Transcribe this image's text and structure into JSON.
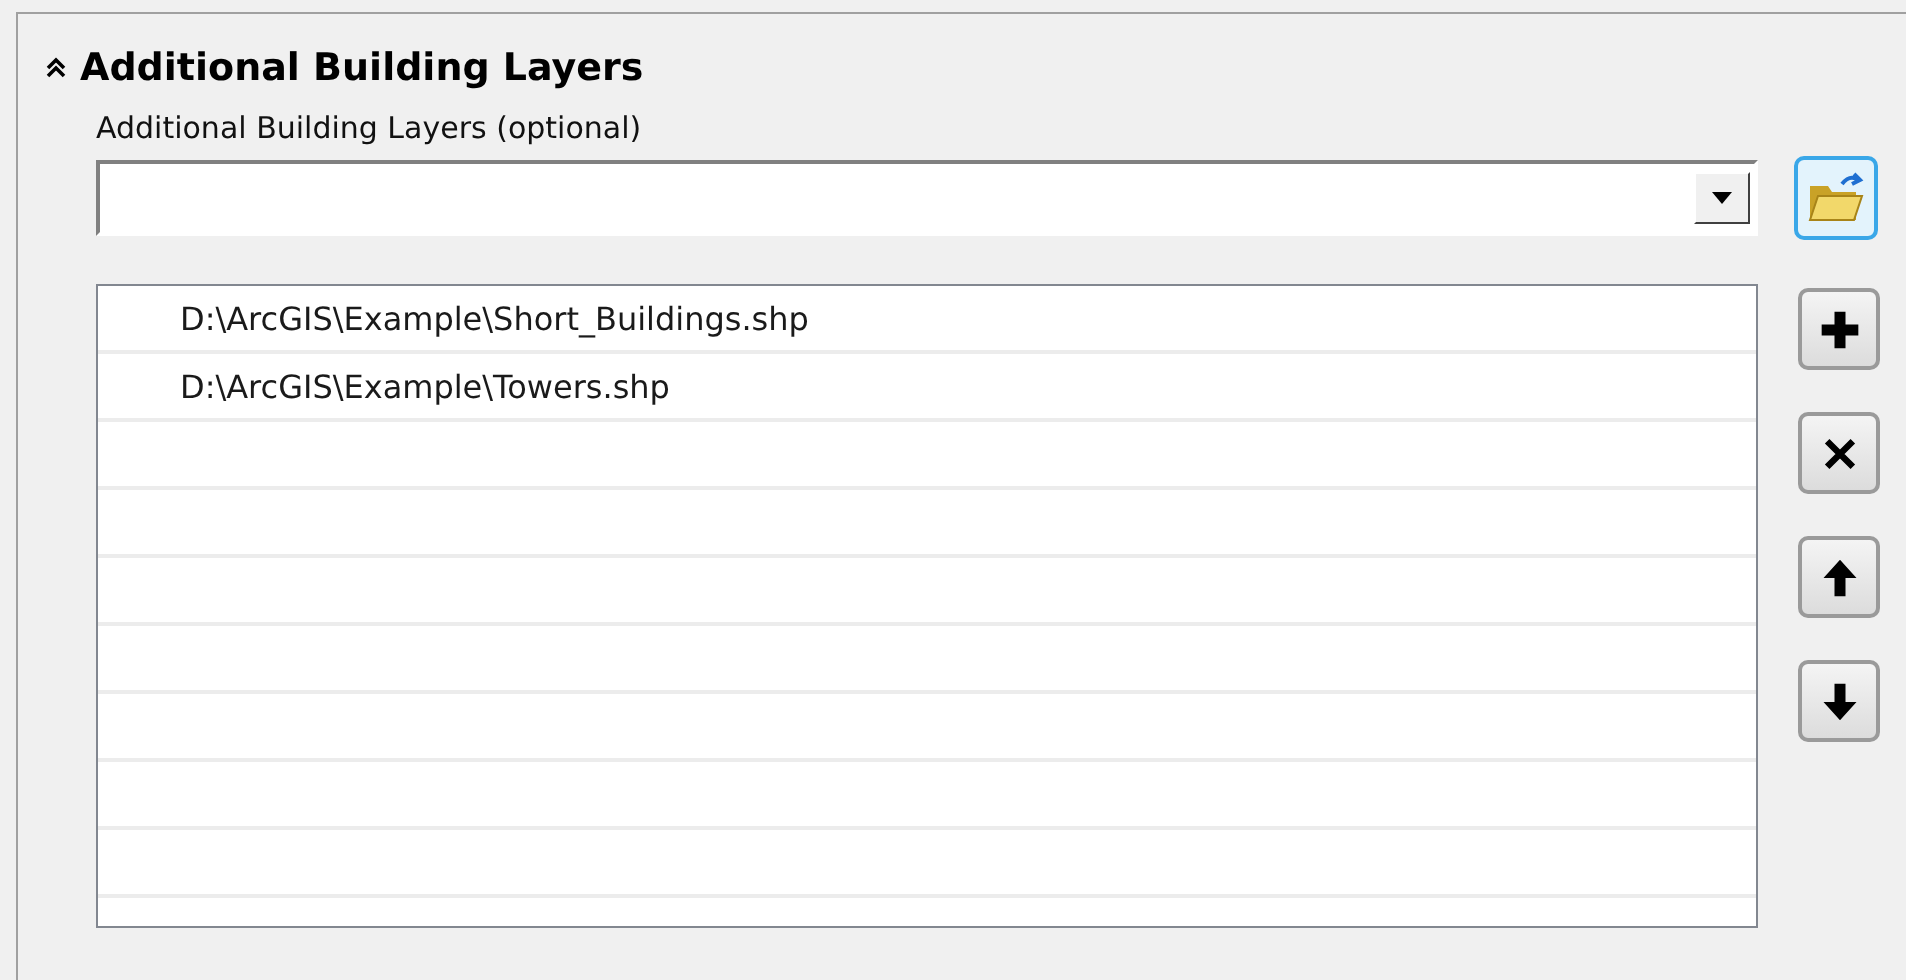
{
  "section": {
    "title": "Additional Building Layers",
    "expanded": true
  },
  "field": {
    "label": "Additional Building Layers (optional)"
  },
  "list": {
    "rows": [
      {
        "path": "D:\\ArcGIS\\Example\\Short_Buildings.shp"
      },
      {
        "path": "D:\\ArcGIS\\Example\\Towers.shp"
      }
    ]
  },
  "side_buttons": [
    {
      "kind": "add"
    },
    {
      "kind": "remove"
    },
    {
      "kind": "up"
    },
    {
      "kind": "down"
    }
  ]
}
